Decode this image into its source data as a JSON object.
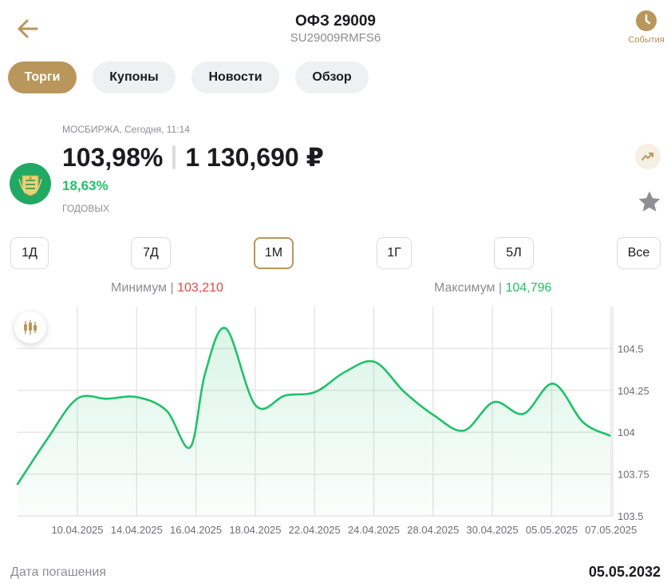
{
  "header": {
    "title": "ОФЗ 29009",
    "subtitle": "SU29009RMFS6",
    "events_label": "События",
    "accent": "#b9965b"
  },
  "tabs": [
    {
      "label": "Торги",
      "active": true
    },
    {
      "label": "Купоны",
      "active": false
    },
    {
      "label": "Новости",
      "active": false
    },
    {
      "label": "Обзор",
      "active": false
    }
  ],
  "quote": {
    "exchange_line": "МОСБИРЖА, Сегодня, 11:14",
    "price_percent": "103,98%",
    "price_rub": "1 130,690 ₽",
    "yield": "18,63%",
    "yield_label": "ГОДОВЫХ"
  },
  "periods": [
    {
      "label": "1Д",
      "active": false
    },
    {
      "label": "7Д",
      "active": false
    },
    {
      "label": "1М",
      "active": true
    },
    {
      "label": "1Г",
      "active": false
    },
    {
      "label": "5Л",
      "active": false
    },
    {
      "label": "Все",
      "active": false
    }
  ],
  "range": {
    "min_label": "Минимум",
    "min_value": "103,210",
    "max_label": "Максимум",
    "max_value": "104,796",
    "separator": "|"
  },
  "chart_data": {
    "type": "area",
    "color": "#21c16b",
    "ylim": [
      103.5,
      104.75
    ],
    "yticks": [
      103.5,
      103.75,
      104,
      104.25,
      104.5
    ],
    "ytick_labels": [
      "103.5",
      "103.75",
      "104",
      "104.25",
      "104.5"
    ],
    "xtick_labels": [
      "10.04.2025",
      "14.04.2025",
      "16.04.2025",
      "18.04.2025",
      "22.04.2025",
      "24.04.2025",
      "28.04.2025",
      "30.04.2025",
      "05.05.2025",
      "07.05.2025"
    ],
    "x": [
      0,
      0.5,
      1,
      1.5,
      2,
      2.5,
      2.9,
      3.15,
      3.5,
      4,
      4.5,
      5,
      5.5,
      6,
      6.5,
      7,
      7.5,
      8,
      8.5,
      9,
      9.5,
      9.95
    ],
    "y": [
      103.69,
      103.96,
      104.2,
      104.2,
      104.21,
      104.13,
      103.91,
      104.35,
      104.62,
      104.16,
      104.22,
      104.24,
      104.36,
      104.42,
      104.24,
      104.1,
      104.01,
      104.18,
      104.11,
      104.29,
      104.06,
      103.98
    ],
    "grid": true
  },
  "footer": {
    "maturity_label": "Дата погашения",
    "maturity_value": "05.05.2032"
  }
}
